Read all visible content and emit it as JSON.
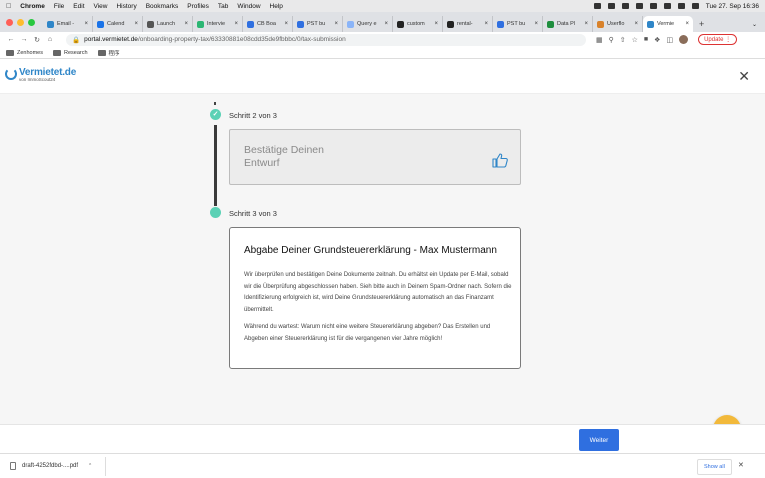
{
  "menubar": {
    "app": "Chrome",
    "items": [
      "File",
      "Edit",
      "View",
      "History",
      "Bookmarks",
      "Profiles",
      "Tab",
      "Window",
      "Help"
    ],
    "datetime": "Tue 27. Sep 16:36"
  },
  "tabs": [
    {
      "label": "Email -",
      "color": "#2f86c8"
    },
    {
      "label": "Calend",
      "color": "#1a73e8"
    },
    {
      "label": "Launch",
      "color": "#555555"
    },
    {
      "label": "Intervie",
      "color": "#2bb673"
    },
    {
      "label": "CB Boa",
      "color": "#2f6fe0"
    },
    {
      "label": "PST bu",
      "color": "#2f6fe0"
    },
    {
      "label": "Query e",
      "color": "#8ab4f8"
    },
    {
      "label": "custom",
      "color": "#222222"
    },
    {
      "label": "rental-",
      "color": "#222222"
    },
    {
      "label": "PST bu",
      "color": "#2f6fe0"
    },
    {
      "label": "Data Pl",
      "color": "#1e8e3e"
    },
    {
      "label": "Userflo",
      "color": "#d9822b"
    },
    {
      "label": "Vermie",
      "color": "#2f86c8",
      "active": true
    }
  ],
  "address": {
    "host": "portal.vermietet.de",
    "path": "/onboarding-property-tax/63330881e08cdd35de9fbbbc/0/tax-submission",
    "update_label": "Update"
  },
  "bookmarks": [
    "Zenhomes",
    "Research",
    "程序"
  ],
  "logo": {
    "name": "Vermietet.de",
    "sub": "von ImmoScout24"
  },
  "steps": {
    "step2_label": "Schritt 2 von 3",
    "step2_card_line1": "Bestätige Deinen",
    "step2_card_line2": "Entwurf",
    "step3_label": "Schritt 3 von 3",
    "step3_title": "Abgabe Deiner Grundsteuererklärung - Max Mustermann",
    "step3_p1": "Wir überprüfen und bestätigen Deine Dokumente zeitnah. Du erhältst ein Update per E-Mail, sobald wir die Überprüfung abgeschlossen haben. Sieh bitte auch in Deinem Spam-Ordner nach. Sofern die Identifizierung erfolgreich ist, wird Deine Grundsteuererklärung automatisch an das Finanzamt übermittelt.",
    "step3_p2": "Während du wartest: Warum nicht eine weitere Steuererklärung abgeben? Das Erstellen und Abgeben einer Steuererklärung ist für die vergangenen vier Jahre möglich!"
  },
  "footer": {
    "next_label": "Weiter"
  },
  "downloads": {
    "file": "draft-4252fdbd-....pdf",
    "show_all": "Show all"
  }
}
